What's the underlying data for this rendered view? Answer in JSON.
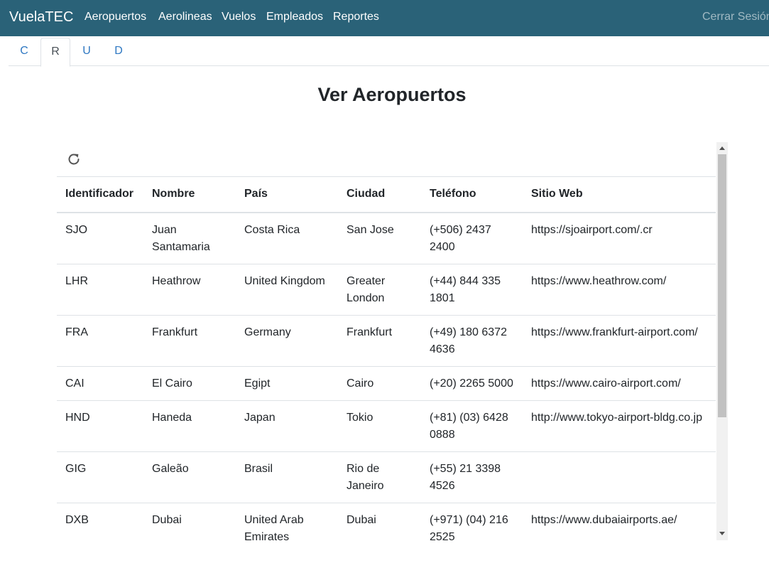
{
  "navbar": {
    "brand": "VuelaTEC",
    "links": [
      "Aeropuertos",
      "Aerolineas",
      "Vuelos",
      "Empleados",
      "Reportes"
    ],
    "logout": "Cerrar Sesión"
  },
  "tabs": [
    "C",
    "R",
    "U",
    "D"
  ],
  "active_tab": "R",
  "page": {
    "title": "Ver Aeropuertos"
  },
  "table": {
    "headers": [
      "Identificador",
      "Nombre",
      "País",
      "Ciudad",
      "Teléfono",
      "Sitio Web"
    ],
    "rows": [
      [
        "SJO",
        "Juan Santamaria",
        "Costa Rica",
        "San Jose",
        "(+506) 2437 2400",
        "https://sjoairport.com/.cr"
      ],
      [
        "LHR",
        "Heathrow",
        "United Kingdom",
        "Greater London",
        "(+44) 844 335 1801",
        "https://www.heathrow.com/"
      ],
      [
        "FRA",
        "Frankfurt",
        "Germany",
        "Frankfurt",
        "(+49) 180 6372 4636",
        "https://www.frankfurt-airport.com/"
      ],
      [
        "CAI",
        "El Cairo",
        "Egipt",
        "Cairo",
        "(+20) 2265 5000",
        "https://www.cairo-airport.com/"
      ],
      [
        "HND",
        "Haneda",
        "Japan",
        "Tokio",
        "(+81) (03) 6428 0888",
        "http://www.tokyo-airport-bldg.co.jp"
      ],
      [
        "GIG",
        "Galeão",
        "Brasil",
        "Rio de Janeiro",
        "(+55) 21 3398 4526",
        ""
      ],
      [
        "DXB",
        "Dubai",
        "United Arab Emirates",
        "Dubai",
        "(+971) (04) 216 2525",
        "https://www.dubaiairports.ae/"
      ]
    ]
  },
  "icons": {
    "refresh": "refresh-icon"
  },
  "colors": {
    "navbar": "#2a6278",
    "tab_link": "#2f78c2"
  }
}
